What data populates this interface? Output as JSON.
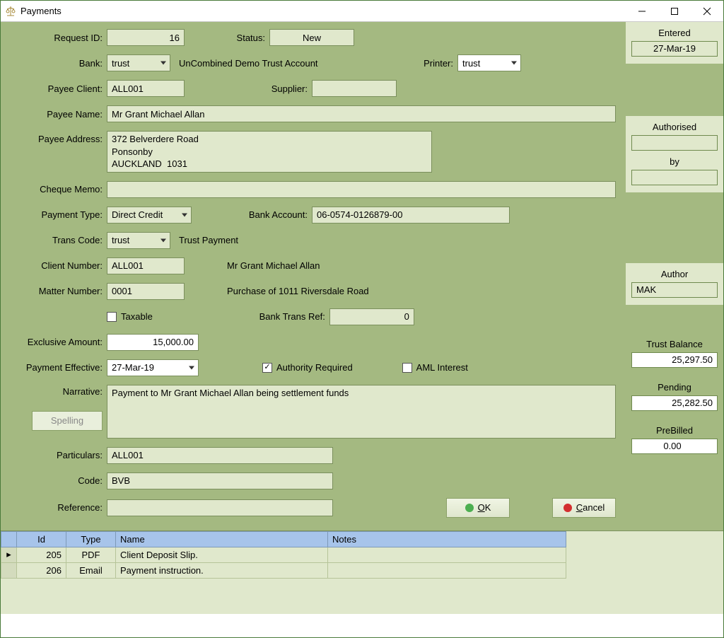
{
  "window": {
    "title": "Payments"
  },
  "labels": {
    "request_id": "Request ID:",
    "status": "Status:",
    "bank": "Bank:",
    "printer": "Printer:",
    "payee_client": "Payee Client:",
    "supplier": "Supplier:",
    "payee_name": "Payee Name:",
    "payee_address": "Payee Address:",
    "cheque_memo": "Cheque Memo:",
    "payment_type": "Payment Type:",
    "bank_account": "Bank Account:",
    "trans_code": "Trans Code:",
    "client_number": "Client Number:",
    "matter_number": "Matter Number:",
    "taxable": "Taxable",
    "bank_trans_ref": "Bank Trans Ref:",
    "exclusive_amount": "Exclusive Amount:",
    "payment_effective": "Payment Effective:",
    "authority_required": "Authority Required",
    "aml_interest": "AML Interest",
    "narrative": "Narrative:",
    "particulars": "Particulars:",
    "code": "Code:",
    "reference": "Reference:"
  },
  "form": {
    "request_id": "16",
    "status": "New",
    "bank": "trust",
    "bank_desc": "UnCombined Demo Trust Account",
    "printer": "trust",
    "payee_client": "ALL001",
    "supplier": "",
    "payee_name": "Mr Grant Michael Allan",
    "payee_address": "372 Belverdere Road\nPonsonby\nAUCKLAND  1031",
    "cheque_memo": "",
    "payment_type": "Direct Credit",
    "bank_account": "06-0574-0126879-00",
    "trans_code": "trust",
    "trans_code_desc": "Trust Payment",
    "client_number": "ALL001",
    "client_desc": "Mr Grant Michael Allan",
    "matter_number": "0001",
    "matter_desc": "Purchase of 1011 Riversdale Road",
    "taxable": false,
    "bank_trans_ref": "0",
    "exclusive_amount": "15,000.00",
    "payment_effective": "27-Mar-19",
    "authority_required": true,
    "aml_interest": false,
    "narrative": "Payment to Mr Grant Michael Allan being settlement funds",
    "particulars": "ALL001",
    "code": "BVB",
    "reference": ""
  },
  "side": {
    "entered_label": "Entered",
    "entered_value": "27-Mar-19",
    "authorised_label": "Authorised",
    "authorised_value": "",
    "by_label": "by",
    "by_value": "",
    "author_label": "Author",
    "author_value": "MAK",
    "trust_balance_label": "Trust Balance",
    "trust_balance_value": "25,297.50",
    "pending_label": "Pending",
    "pending_value": "25,282.50",
    "prebilled_label": "PreBilled",
    "prebilled_value": "0.00"
  },
  "buttons": {
    "spelling": "Spelling",
    "ok_prefix": "O",
    "ok_rest": "K",
    "cancel_prefix": "C",
    "cancel_rest": "ancel"
  },
  "grid": {
    "headers": {
      "id": "Id",
      "type": "Type",
      "name": "Name",
      "notes": "Notes"
    },
    "rows": [
      {
        "selector": "▸",
        "id": "205",
        "type": "PDF",
        "name": "Client Deposit Slip.",
        "notes": ""
      },
      {
        "selector": "",
        "id": "206",
        "type": "Email",
        "name": "Payment instruction.",
        "notes": ""
      }
    ]
  }
}
